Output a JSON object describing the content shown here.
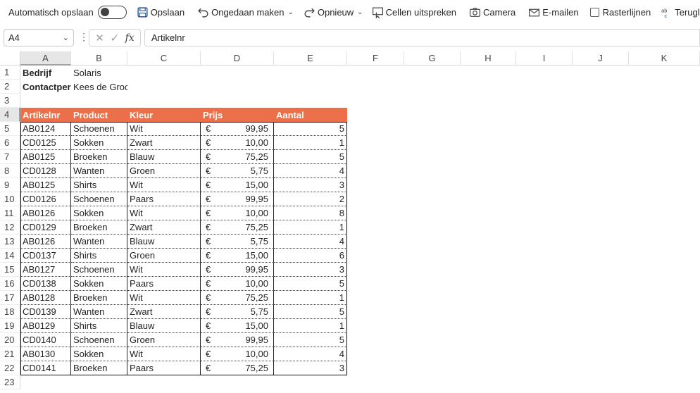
{
  "toolbar": {
    "autosave_label": "Automatisch opslaan",
    "save_label": "Opslaan",
    "undo_label": "Ongedaan maken",
    "redo_label": "Opnieuw",
    "speak_label": "Cellen uitspreken",
    "camera_label": "Camera",
    "email_label": "E-mailen",
    "gridlines_label": "Rasterlijnen",
    "lookup_label": "Terugloop"
  },
  "formula_bar": {
    "name_box": "A4",
    "value": "Artikelnr"
  },
  "columns": [
    "A",
    "B",
    "C",
    "D",
    "E",
    "F",
    "G",
    "H",
    "I",
    "J",
    "K"
  ],
  "rows": [
    "1",
    "2",
    "3",
    "4",
    "5",
    "6",
    "7",
    "8",
    "9",
    "10",
    "11",
    "12",
    "13",
    "14",
    "15",
    "16",
    "17",
    "18",
    "19",
    "20",
    "21",
    "22",
    "23"
  ],
  "info": {
    "company_label": "Bedrijf",
    "company_value": "Solaris",
    "contact_label": "Contactpersoon",
    "contact_value": "Kees de Groot"
  },
  "table": {
    "headers": [
      "Artikelnr",
      "Product",
      "Kleur",
      "Prijs",
      "Aantal"
    ],
    "currency": "€",
    "rows": [
      [
        "AB0124",
        "Schoenen",
        "Wit",
        "99,95",
        "5"
      ],
      [
        "CD0125",
        "Sokken",
        "Zwart",
        "10,00",
        "1"
      ],
      [
        "AB0125",
        "Broeken",
        "Blauw",
        "75,25",
        "5"
      ],
      [
        "CD0128",
        "Wanten",
        "Groen",
        "5,75",
        "4"
      ],
      [
        "AB0125",
        "Shirts",
        "Wit",
        "15,00",
        "3"
      ],
      [
        "CD0126",
        "Schoenen",
        "Paars",
        "99,95",
        "2"
      ],
      [
        "AB0126",
        "Sokken",
        "Wit",
        "10,00",
        "8"
      ],
      [
        "CD0129",
        "Broeken",
        "Zwart",
        "75,25",
        "1"
      ],
      [
        "AB0126",
        "Wanten",
        "Blauw",
        "5,75",
        "4"
      ],
      [
        "CD0137",
        "Shirts",
        "Groen",
        "15,00",
        "6"
      ],
      [
        "AB0127",
        "Schoenen",
        "Wit",
        "99,95",
        "3"
      ],
      [
        "CD0138",
        "Sokken",
        "Paars",
        "10,00",
        "5"
      ],
      [
        "AB0128",
        "Broeken",
        "Wit",
        "75,25",
        "1"
      ],
      [
        "CD0139",
        "Wanten",
        "Zwart",
        "5,75",
        "5"
      ],
      [
        "AB0129",
        "Shirts",
        "Blauw",
        "15,00",
        "1"
      ],
      [
        "CD0140",
        "Schoenen",
        "Groen",
        "99,95",
        "5"
      ],
      [
        "AB0130",
        "Sokken",
        "Wit",
        "10,00",
        "4"
      ],
      [
        "CD0141",
        "Broeken",
        "Paars",
        "75,25",
        "3"
      ]
    ]
  },
  "colors": {
    "header_fill": "#eb6f48",
    "header_text": "#ffffff"
  }
}
